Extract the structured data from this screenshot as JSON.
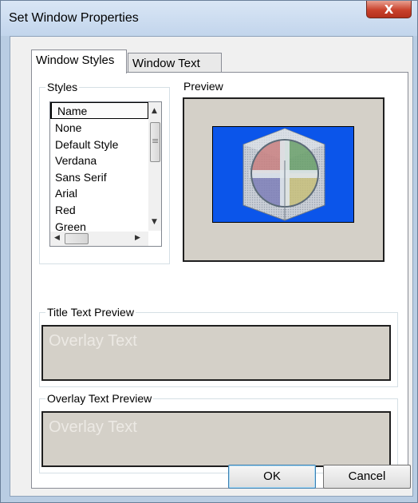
{
  "window": {
    "title": "Set Window Properties",
    "close_glyph": "X"
  },
  "tabs": [
    {
      "label": "Window Styles",
      "selected": true
    },
    {
      "label": "Window Text",
      "selected": false
    }
  ],
  "styles_group": {
    "label": "Styles",
    "list_header": "Name",
    "items": [
      "None",
      "Default Style",
      "Verdana",
      "Sans Serif",
      "Arial",
      "Red",
      "Green"
    ]
  },
  "preview_group": {
    "label": "Preview"
  },
  "title_preview": {
    "label": "Title Text Preview",
    "text": "Overlay Text"
  },
  "overlay_preview": {
    "label": "Overlay Text Preview",
    "text": "Overlay Text"
  },
  "buttons": {
    "ok": "OK",
    "cancel": "Cancel"
  },
  "icons": {
    "scroll_up": "▲",
    "scroll_down": "▼",
    "scroll_left": "◀",
    "scroll_right": "▶",
    "grip": "≡"
  },
  "colors": {
    "preview_background": "#0b55ea",
    "panel_gray": "#d4d0c8",
    "close_red": "#c9422c"
  }
}
